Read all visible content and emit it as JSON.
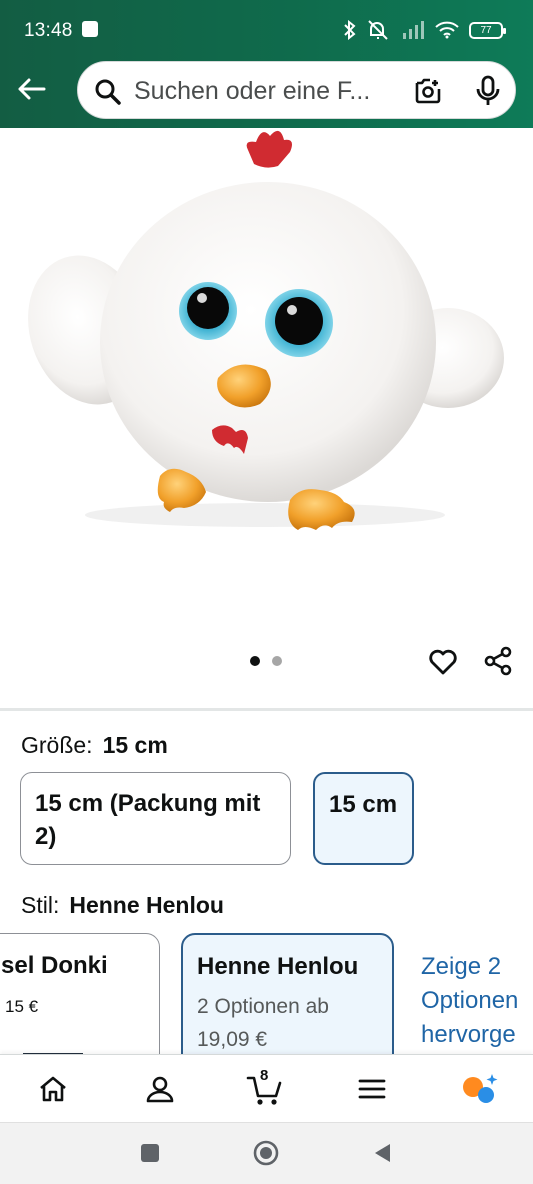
{
  "status_bar": {
    "time": "13:48",
    "battery": "77"
  },
  "header": {
    "search_placeholder": "Suchen oder eine F...",
    "icons": [
      "back-arrow-icon",
      "search-icon",
      "camera-icon",
      "microphone-icon"
    ]
  },
  "gallery": {
    "page_count": 2,
    "active_page": 1
  },
  "size": {
    "label": "Größe:",
    "selected": "15 cm",
    "options": [
      {
        "label": "15 cm (Packung mit 2)",
        "selected": false
      },
      {
        "label": "15 cm",
        "selected": true
      }
    ]
  },
  "style": {
    "label": "Stil:",
    "selected": "Henne Henlou",
    "cards": [
      {
        "name": "sel Donki",
        "price": "15 €",
        "selected": false
      },
      {
        "name": "Henne Henlou",
        "sub": "2 Optionen ab 19,09 €",
        "selected": true
      }
    ],
    "more_link": "Zeige 2 Optionen hervorge"
  },
  "bottom_nav": {
    "cart_count": "8",
    "items": [
      "home-icon",
      "account-icon",
      "cart-icon",
      "menu-icon",
      "rufus-icon"
    ]
  },
  "colors": {
    "header_start": "#135d43",
    "header_end": "#0e7b58",
    "selected_border": "#2b5c8b",
    "selected_bg": "#edf6fd",
    "link": "#1f65a6"
  }
}
